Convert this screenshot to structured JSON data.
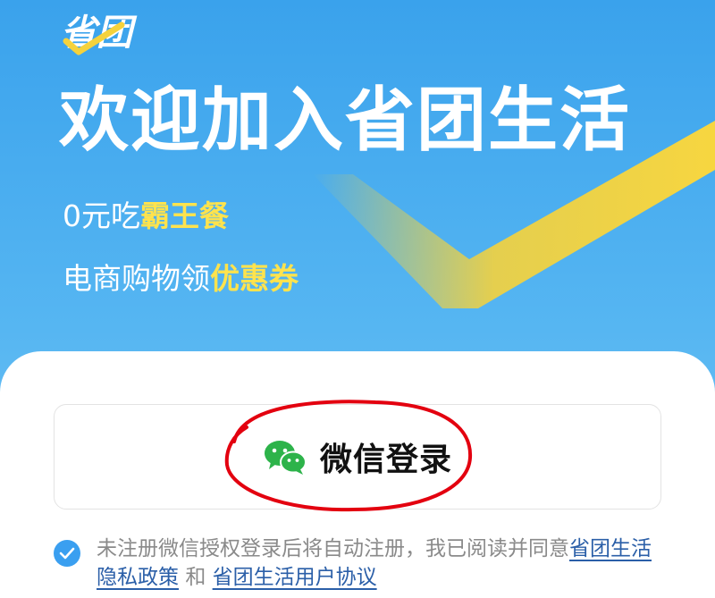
{
  "logo": {
    "text": "省团",
    "icon": "sheng-tuan-logo-icon"
  },
  "hero": {
    "title": "欢迎加入省团生活",
    "line1_prefix": "0元吃",
    "line1_highlight": "霸王餐",
    "line2_prefix": "电商购物领",
    "line2_highlight": "优惠券"
  },
  "login": {
    "button_label": "微信登录",
    "icon": "wechat-icon"
  },
  "agreement": {
    "checked": true,
    "text": "未注册微信授权登录后将自动注册，我已阅读并同意",
    "privacy_link": "省团生活隐私政策",
    "and": "和",
    "terms_link": "省团生活用户协议"
  },
  "colors": {
    "background_top": "#3aa2ec",
    "highlight": "#ffe34d",
    "check_yellow": "#f5d23c",
    "link": "#2b5fa8",
    "accent_blue": "#3a9ff0",
    "wechat_green": "#2db34a",
    "annotation_red": "#e3000f"
  }
}
